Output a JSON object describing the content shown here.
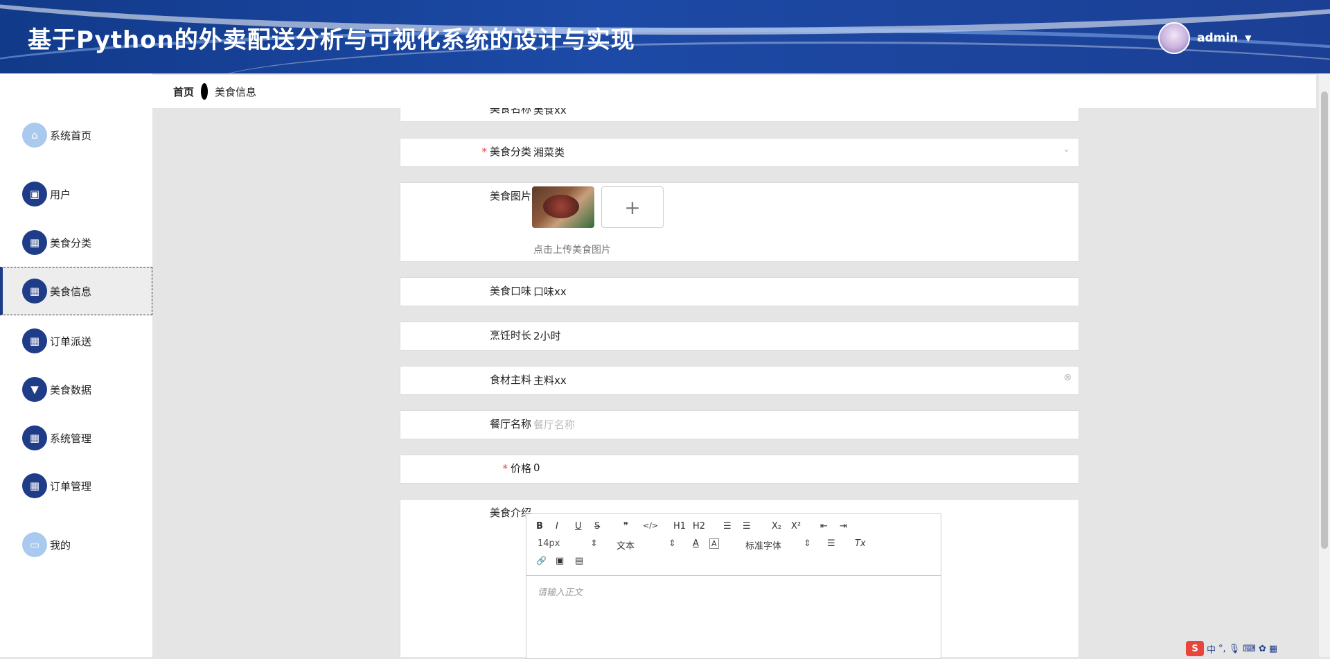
{
  "header": {
    "title": "基于Python的外卖配送分析与可视化系统的设计与实现",
    "username": "admin"
  },
  "breadcrumb": {
    "home": "首页",
    "current": "美食信息"
  },
  "sidebar": {
    "items": [
      {
        "label": "系统首页",
        "icon": "home-icon"
      },
      {
        "label": "用户",
        "icon": "user-icon"
      },
      {
        "label": "美食分类",
        "icon": "grid-icon"
      },
      {
        "label": "美食信息",
        "icon": "grid-icon"
      },
      {
        "label": "订单派送",
        "icon": "grid-icon"
      },
      {
        "label": "美食数据",
        "icon": "chart-icon"
      },
      {
        "label": "系统管理",
        "icon": "table-icon"
      },
      {
        "label": "订单管理",
        "icon": "grid-icon"
      },
      {
        "label": "我的",
        "icon": "card-icon"
      }
    ]
  },
  "form": {
    "name": {
      "label": "美食名称",
      "value": "美食xx"
    },
    "category": {
      "label": "美食分类",
      "value": "湘菜类"
    },
    "image": {
      "label": "美食图片",
      "hint": "点击上传美食图片",
      "add": "+"
    },
    "taste": {
      "label": "美食口味",
      "value": "口味xx"
    },
    "cook_time": {
      "label": "烹饪时长",
      "value": "2小时"
    },
    "ingredient": {
      "label": "食材主料",
      "value": "主料xx"
    },
    "restaurant": {
      "label": "餐厅名称",
      "placeholder": "餐厅名称"
    },
    "price": {
      "label": "价格",
      "value": "0"
    },
    "intro": {
      "label": "美食介绍",
      "placeholder": "请输入正文"
    }
  },
  "editor": {
    "font_size": "14px",
    "block_type": "文本",
    "font_family": "标准字体",
    "buttons": {
      "bold": "B",
      "italic": "I",
      "underline": "U",
      "strike": "S",
      "quote": "❞",
      "code": "</>",
      "h1": "H1",
      "h2": "H2",
      "ol": "☰",
      "ul": "☰",
      "sub": "X₂",
      "sup": "X²",
      "outdent": "⇤",
      "indent": "⇥",
      "color": "A",
      "bg": "A",
      "align": "☰",
      "clear": "Tx",
      "link": "🔗",
      "image": "▣",
      "video": "▤"
    }
  },
  "tray": {
    "ime": "S",
    "lang": "中"
  }
}
